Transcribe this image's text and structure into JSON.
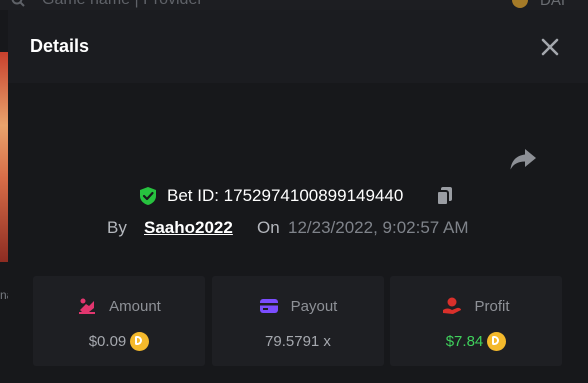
{
  "background": {
    "search_placeholder": "Game name | Provider",
    "currency": "DAI",
    "thumb_caption": "na"
  },
  "modal": {
    "title": "Details",
    "bet": {
      "id_label": "Bet ID: 1752974100899149440",
      "by_label": "By",
      "username": "Saaho2022",
      "on_label": "On",
      "date": "12/23/2022, 9:02:57 AM"
    },
    "stats": [
      {
        "label": "Amount",
        "value": "$0.09",
        "icon": "amount-icon",
        "coin": true
      },
      {
        "label": "Payout",
        "value": "79.5791 x",
        "icon": "wallet-icon",
        "coin": false
      },
      {
        "label": "Profit",
        "value": "$7.84",
        "icon": "profit-icon",
        "coin": true
      }
    ]
  },
  "colors": {
    "verified_green": "#27c23f",
    "amount_pink": "#e2366f",
    "payout_purple": "#7b4dff",
    "profit_red": "#d9302b",
    "profit_text_green": "#3fd15c",
    "coin_gold": "#f4b92c"
  }
}
